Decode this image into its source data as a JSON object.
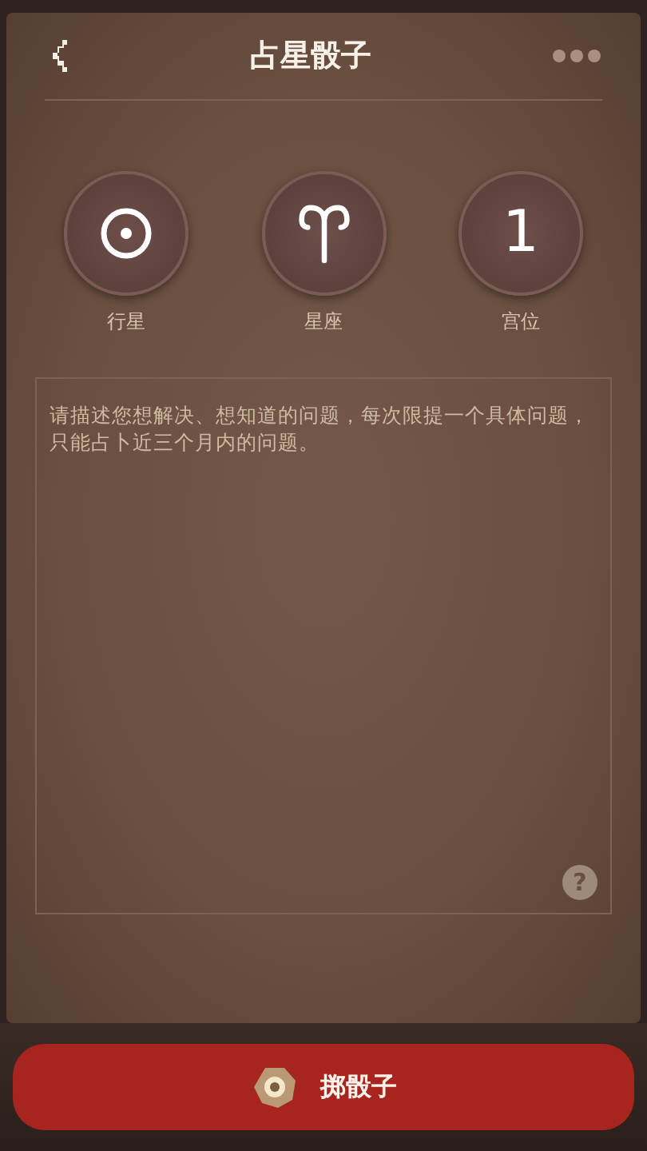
{
  "header": {
    "title": "占星骰子"
  },
  "dice": [
    {
      "kind": "planet",
      "label": "行星"
    },
    {
      "kind": "sign",
      "label": "星座"
    },
    {
      "kind": "house",
      "face": "1",
      "label": "宫位"
    }
  ],
  "question": {
    "placeholder": "请描述您想解决、想知道的问题，每次限提一个具体问题，只能占卜近三个月内的问题。",
    "help": "?"
  },
  "roll_button": {
    "label": "掷骰子"
  }
}
